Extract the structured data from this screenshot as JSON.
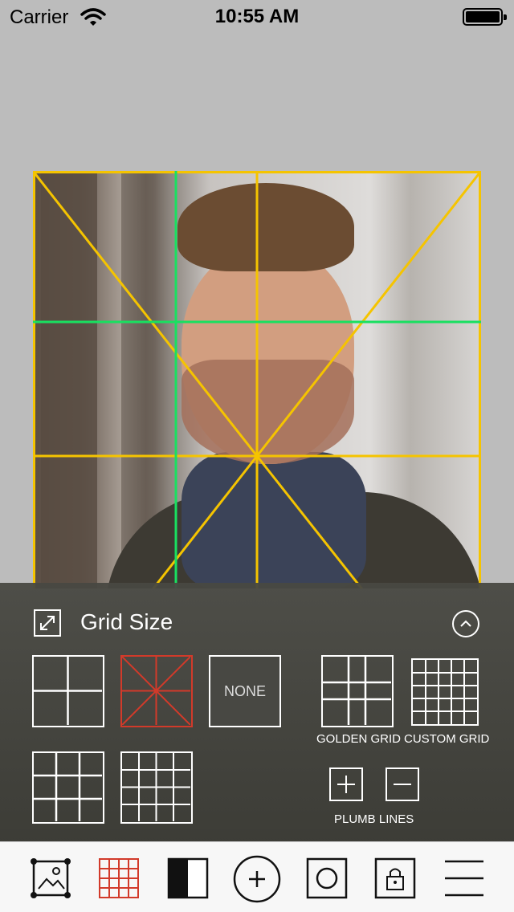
{
  "status_bar": {
    "carrier": "Carrier",
    "time": "10:55 AM"
  },
  "photo": {
    "subject": "portrait-photo"
  },
  "grid_panel": {
    "title": "Grid Size",
    "none_label": "NONE",
    "golden_grid_label": "GOLDEN GRID",
    "custom_grid_label": "CUSTOM GRID",
    "plumb_lines_label": "PLUMB LINES",
    "selected_color": "#d23a2a"
  },
  "overlay_colors": {
    "golden": "#f5c400",
    "thirds": "#19e060"
  },
  "toolbar": {
    "items": [
      "photo-icon",
      "grid-icon",
      "contrast-icon",
      "add-icon",
      "circle-icon",
      "lock-icon",
      "menu-icon"
    ]
  }
}
